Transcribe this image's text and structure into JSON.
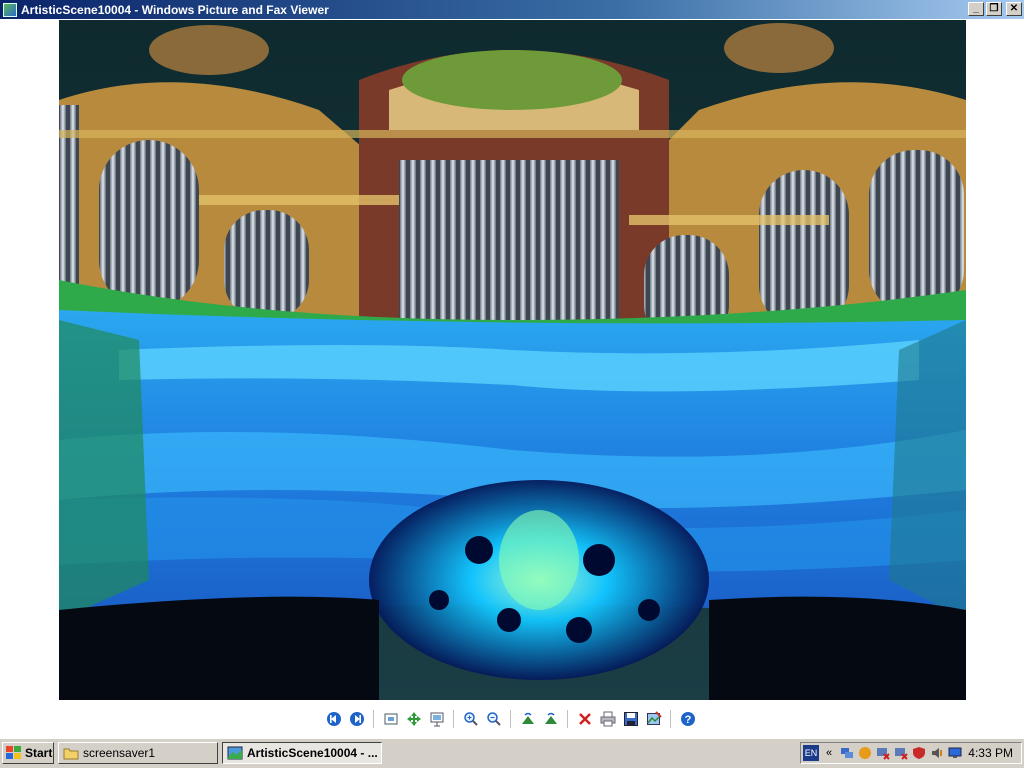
{
  "window": {
    "title": "ArtisticScene10004 - Windows Picture and Fax Viewer",
    "icon": "picture-viewer-icon",
    "controls": [
      "minimize-icon",
      "restore-icon",
      "close-icon"
    ]
  },
  "toolbar": {
    "buttons": [
      {
        "name": "previous-image-button",
        "icon": "previous-icon"
      },
      {
        "name": "next-image-button",
        "icon": "next-icon"
      },
      {
        "name": "best-fit-button",
        "icon": "best-fit-icon"
      },
      {
        "name": "actual-size-button",
        "icon": "actual-size-icon"
      },
      {
        "name": "slideshow-button",
        "icon": "slideshow-icon"
      },
      {
        "name": "zoom-in-button",
        "icon": "zoom-in-icon"
      },
      {
        "name": "zoom-out-button",
        "icon": "zoom-out-icon"
      },
      {
        "name": "rotate-clockwise-button",
        "icon": "rotate-clockwise-icon"
      },
      {
        "name": "rotate-counterclockwise-button",
        "icon": "rotate-counterclockwise-icon"
      },
      {
        "name": "delete-button",
        "icon": "delete-icon"
      },
      {
        "name": "print-button",
        "icon": "print-icon"
      },
      {
        "name": "save-button",
        "icon": "save-icon"
      },
      {
        "name": "edit-button",
        "icon": "edit-icon"
      },
      {
        "name": "help-button",
        "icon": "help-icon"
      }
    ]
  },
  "taskbar": {
    "start_label": "Start",
    "tasks": [
      {
        "label": "screensaver1",
        "icon": "folder-icon",
        "active": false
      },
      {
        "label": "ArtisticScene10004 - ...",
        "icon": "picture-viewer-icon",
        "active": true
      }
    ],
    "tray": {
      "language": "EN",
      "chevron": "«",
      "clock": "4:33 PM"
    }
  },
  "colors": {
    "titlebar_start": "#0a246a",
    "titlebar_end": "#a6caf0",
    "chrome": "#d4d0c8",
    "accent_blue": "#1e64c8"
  }
}
